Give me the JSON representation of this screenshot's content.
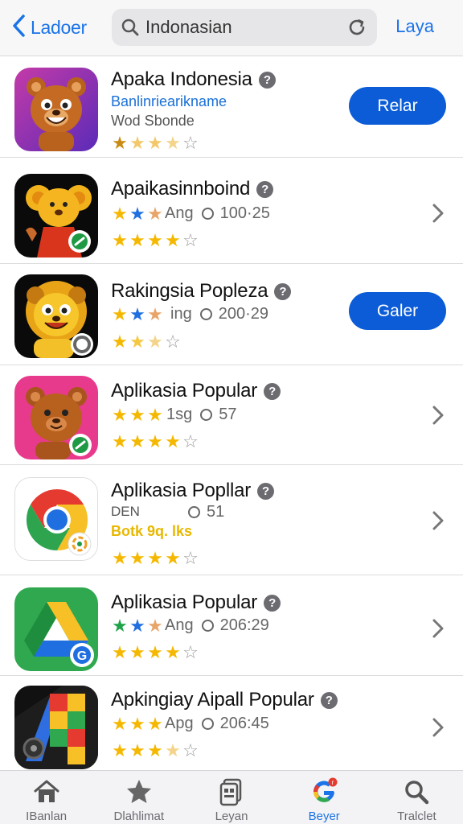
{
  "header": {
    "back_label": "Ladoer",
    "search_value": "Indonasian",
    "action_label": "Laya"
  },
  "apps": [
    {
      "title": "Apaka Indonesia",
      "developer": "Banlinriearikname",
      "category": "Wod Sbonde",
      "button": "Relar",
      "icon": "bear-purple-icon"
    },
    {
      "title": "Apaikasinnboind",
      "inline_stars": "Ang",
      "meta": "100·25",
      "icon": "bear-red-icon"
    },
    {
      "title": "Rakingsia Popleza",
      "inline_stars": "ing",
      "meta": "200·29",
      "button": "Galer",
      "icon": "lion-yellow-icon"
    },
    {
      "title": "Aplikasia Popular",
      "inline_stars": "1sg",
      "meta": "57",
      "icon": "bear-pink-icon"
    },
    {
      "title": "Aplikasia Popllar",
      "line1": "DEN",
      "line2": "Botk 9q. lks",
      "meta": "51",
      "icon": "chrome-icon"
    },
    {
      "title": "Aplikasia Popular",
      "inline_stars": "Ang",
      "meta": "206:29",
      "icon": "drive-icon"
    },
    {
      "title": "Apkingiay Aipall Popular",
      "inline_stars": "Apg",
      "meta": "206:45",
      "icon": "game-icon"
    }
  ],
  "tabs": [
    {
      "label": "IBanlan",
      "icon": "home-icon"
    },
    {
      "label": "Dlahlimat",
      "icon": "star-icon"
    },
    {
      "label": "Leyan",
      "icon": "apps-icon"
    },
    {
      "label": "Beyer",
      "icon": "google-icon",
      "active": true
    },
    {
      "label": "Tralclet",
      "icon": "search-icon"
    }
  ],
  "colors": {
    "accent": "#1a73e8",
    "button": "#0b5cd6",
    "star_gold": "#f5b800",
    "star_blue": "#1f6fe0",
    "star_green": "#1fa34a"
  }
}
